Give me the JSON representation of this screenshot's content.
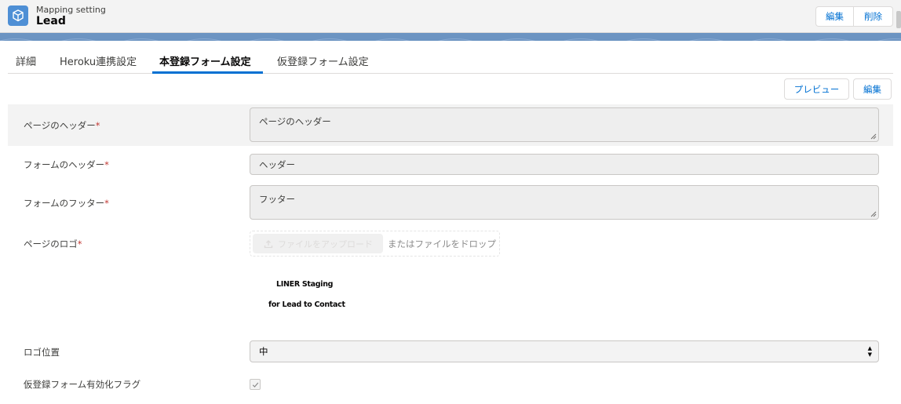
{
  "header": {
    "subtitle": "Mapping setting",
    "title": "Lead",
    "icon": "cube-icon",
    "edit_label": "編集",
    "delete_label": "削除"
  },
  "tabs": [
    {
      "label": "詳細",
      "active": false
    },
    {
      "label": "Heroku連携設定",
      "active": false
    },
    {
      "label": "本登録フォーム設定",
      "active": true
    },
    {
      "label": "仮登録フォーム設定",
      "active": false
    }
  ],
  "actions": {
    "preview_label": "プレビュー",
    "edit_label": "編集"
  },
  "form": {
    "page_header": {
      "label": "ページのヘッダー",
      "required_mark": "*",
      "value": "ページのヘッダー"
    },
    "form_header": {
      "label": "フォームのヘッダー",
      "required_mark": "*",
      "value": "ヘッダー"
    },
    "form_footer": {
      "label": "フォームのフッター",
      "required_mark": "*",
      "value": "フッター"
    },
    "page_logo": {
      "label": "ページのロゴ",
      "required_mark": "*",
      "upload_label": "ファイルをアップロード",
      "drop_text": "またはファイルをドロップ",
      "logo_line1": "LINER Staging",
      "logo_line2": "for Lead to Contact"
    },
    "logo_position": {
      "label": "ロゴ位置",
      "value": "中"
    },
    "provisional_flag": {
      "label": "仮登録フォーム有効化フラグ",
      "checked": true
    }
  },
  "colors": {
    "accent": "#0070d2",
    "required": "#c23934",
    "banner": "#6c94c2",
    "icon_bg": "#4e8fd5"
  }
}
